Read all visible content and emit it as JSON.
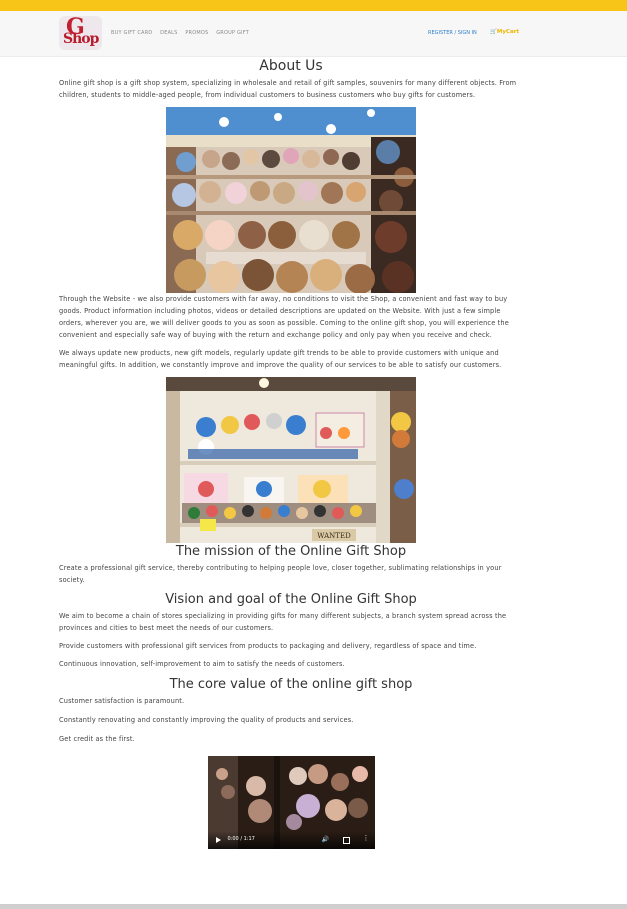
{
  "colors": {
    "accent_bar": "#f7c518",
    "nav_bg": "#f7f7f7",
    "link_blue": "#2f7fc9",
    "cart_yellow": "#f0b400",
    "logo_red": "#c0202f"
  },
  "header": {
    "logo_text_top": "G",
    "logo_text_bottom": "Shop",
    "nav": [
      {
        "label": "BUY GIFT CARD"
      },
      {
        "label": "DEALS"
      },
      {
        "label": "PROMOS"
      },
      {
        "label": "GROUP GIFT"
      }
    ],
    "register_label": "REGISTER",
    "signin_label": "SIGN IN",
    "cart_icon": "cart-icon",
    "cart_label": "MyCart"
  },
  "about": {
    "title": "About Us",
    "intro": "Online gift shop is a gift shop system, specializing in wholesale and retail of gift samples, souvenirs for many different objects. From children, students to middle-aged people, from individual customers to business customers who buy gifts for customers.",
    "website_paragraph": "Through the Website - we also provide customers with far away, no conditions to visit the Shop, a convenient and fast way to buy goods. Product information including photos, videos or detailed descriptions are updated on the Website. With just a few simple orders, wherever you are, we will deliver goods to you as soon as possible. Coming to the online gift shop, you will experience the convenient and especially safe way of buying with the return and exchange policy and only pay when you receive and check.",
    "update_paragraph": "We always update new products, new gift models, regularly update gift trends to be able to provide customers with unique and meaningful gifts. In addition, we constantly improve and improve the quality of our services to be able to satisfy our customers."
  },
  "mission": {
    "title": "The mission of the Online Gift Shop",
    "text": "Create a professional gift service, thereby contributing to helping people love, closer together, sublimating relationships in your society."
  },
  "vision": {
    "title": "Vision and goal of the Online Gift Shop",
    "paragraphs": [
      "We aim to become a chain of stores specializing in providing gifts for many different subjects, a branch system spread across the provinces and cities to best meet the needs of our customers.",
      "Provide customers with professional gift services from products to packaging and delivery, regardless of space and time.",
      "Continuous innovation, self-improvement to aim to satisfy the needs of customers."
    ]
  },
  "core_value": {
    "title": "The core value of the online gift shop",
    "paragraphs": [
      "Customer satisfaction is paramount.",
      "Constantly renovating and constantly improving the quality of products and services.",
      "Get credit as the first."
    ]
  },
  "video": {
    "time": "0:00 / 1:17"
  },
  "shelf_sign": "WANTED"
}
